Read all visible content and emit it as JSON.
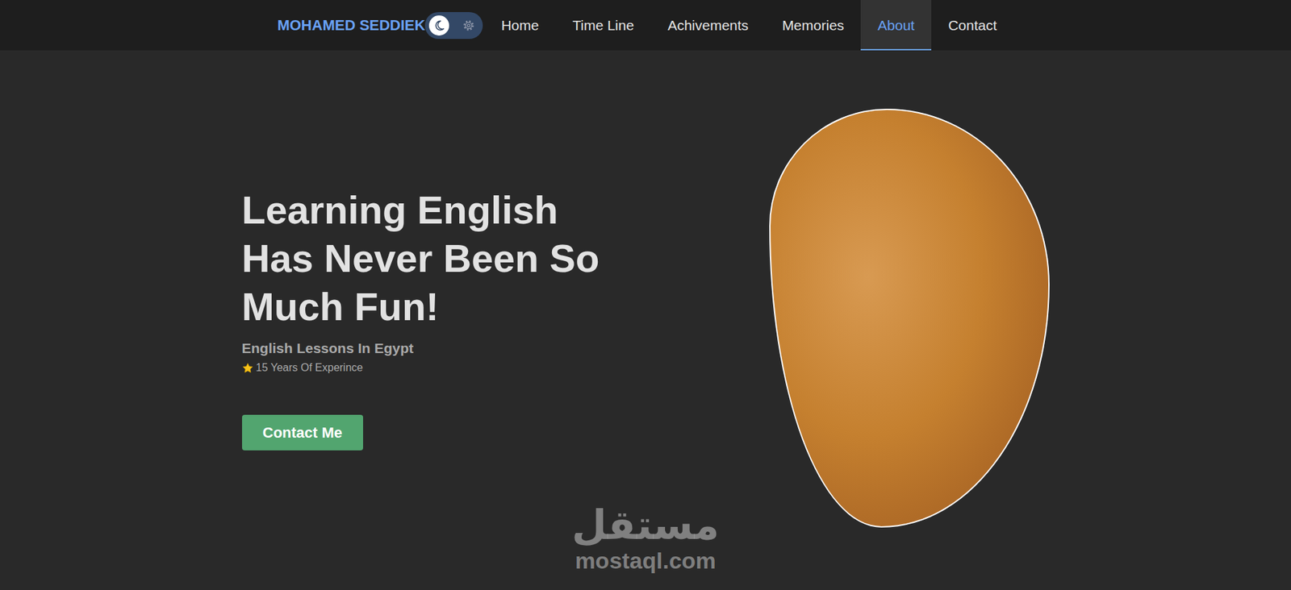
{
  "brand": "MOHAMED SEDDIEK",
  "theme_toggle": {
    "dark": true
  },
  "nav": [
    {
      "label": "Home",
      "selected": false
    },
    {
      "label": "Time Line",
      "selected": false
    },
    {
      "label": "Achivements",
      "selected": false
    },
    {
      "label": "Memories",
      "selected": false
    },
    {
      "label": "About",
      "selected": true
    },
    {
      "label": "Contact",
      "selected": false
    }
  ],
  "hero": {
    "title": "Learning English Has Never Been So Much Fun!",
    "subtitle": "English Lessons In Egypt",
    "experience": "15 Years Of Experince",
    "button": "Contact Me"
  },
  "watermark": {
    "arabic": "مستقل",
    "latin": "mostaql.com"
  }
}
